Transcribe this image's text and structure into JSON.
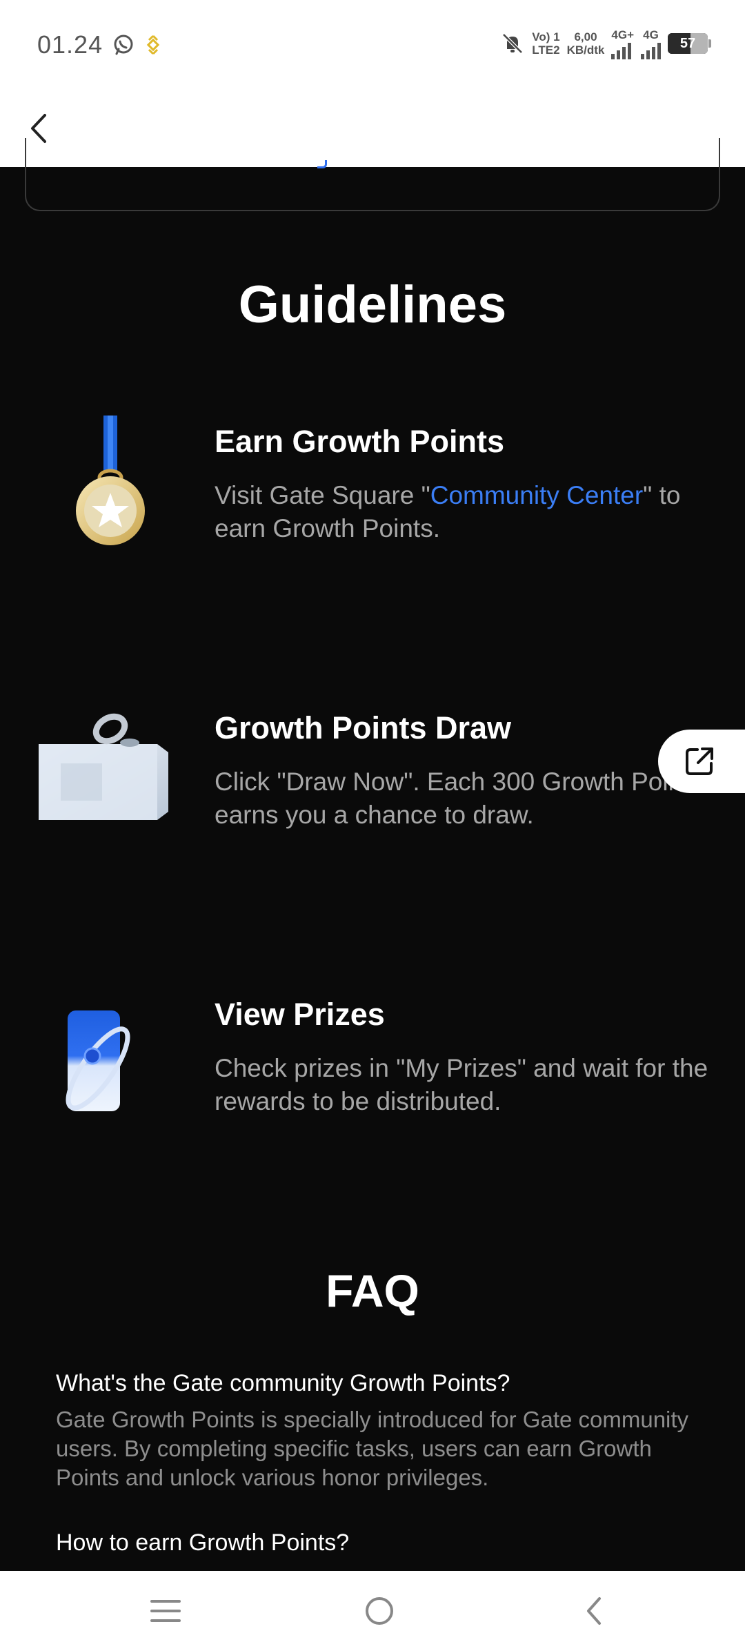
{
  "status_bar": {
    "time": "01.24",
    "network_top": "Vo) 1",
    "network_bottom": "LTE2",
    "speed_value": "6,00",
    "speed_unit": "KB/dtk",
    "sim1_label": "4G+",
    "sim2_label": "4G",
    "battery": "57",
    "battery_level": 0.57,
    "icons": [
      "whatsapp-icon",
      "binance-icon",
      "mute-icon",
      "signal-icon",
      "battery-icon"
    ]
  },
  "header": {
    "back_icon": "chevron-left-icon"
  },
  "guidelines": {
    "title": "Guidelines",
    "steps": [
      {
        "title": "Earn Growth Points",
        "desc_before": "Visit Gate Square \"",
        "desc_link": "Community Center",
        "desc_after": "\" to earn Growth Points.",
        "icon": "medal-icon"
      },
      {
        "title": "Growth Points Draw",
        "desc": "Click \"Draw Now\". Each 300 Growth Points earns you a chance to draw.",
        "icon": "draw-box-icon"
      },
      {
        "title": "View Prizes",
        "desc": "Check prizes in \"My Prizes\" and wait for the rewards to be distributed.",
        "icon": "prize-card-icon"
      }
    ]
  },
  "floating_button": {
    "icon": "share-external-icon"
  },
  "faq": {
    "title": "FAQ",
    "items": [
      {
        "question": "What's the Gate community Growth Points?",
        "answer": "Gate Growth Points is specially introduced for Gate community users. By completing specific tasks, users can earn Growth Points and unlock various honor privileges."
      },
      {
        "question": "How to earn Growth Points?"
      }
    ]
  },
  "nav_bar": {
    "icons": [
      "menu-icon",
      "home-icon",
      "back-icon"
    ]
  },
  "colors": {
    "background": "#0a0a0a",
    "link": "#3b7ef5",
    "text_primary": "#ffffff",
    "text_secondary": "#a7a7a7"
  }
}
